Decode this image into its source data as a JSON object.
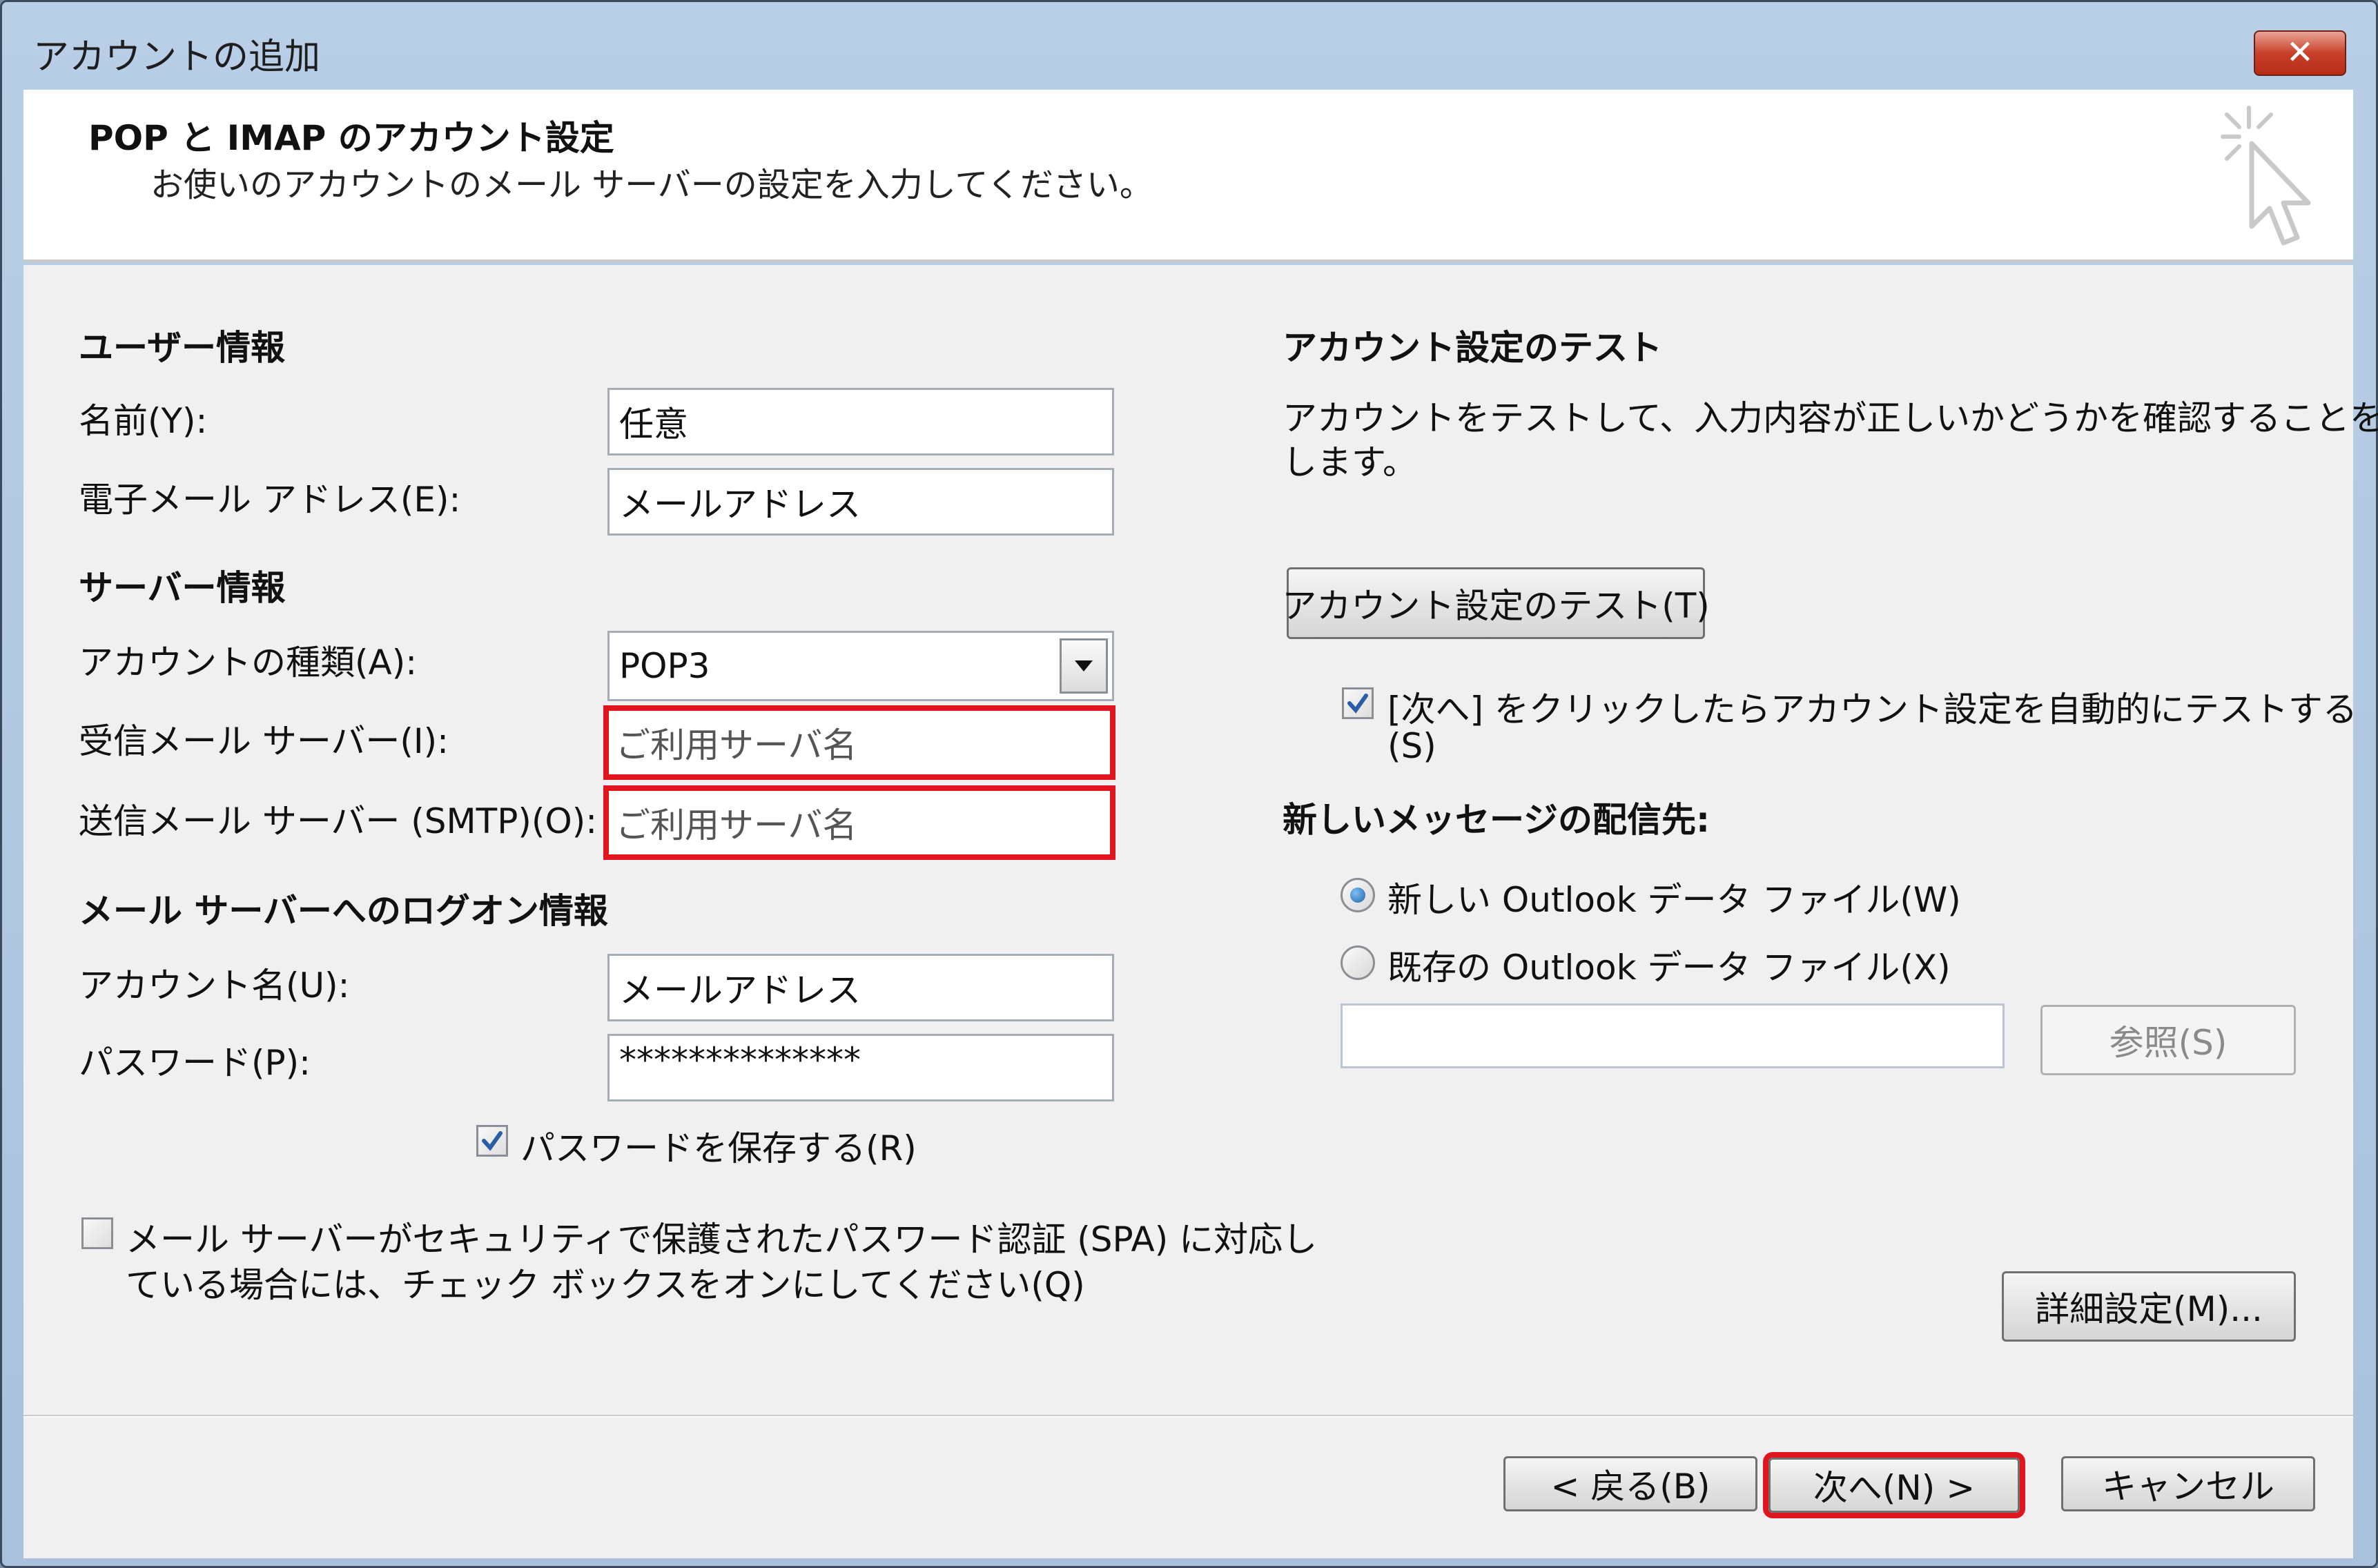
{
  "window": {
    "title": "アカウントの追加",
    "close_glyph": "✕"
  },
  "header": {
    "title": "POP と IMAP のアカウント設定",
    "subtitle": "お使いのアカウントのメール サーバーの設定を入力してください。"
  },
  "user_info": {
    "section_label": "ユーザー情報",
    "name_label": "名前(Y):",
    "name_value": "任意",
    "email_label": "電子メール アドレス(E):",
    "email_value": "メールアドレス"
  },
  "server_info": {
    "section_label": "サーバー情報",
    "account_type_label": "アカウントの種類(A):",
    "account_type_value": "POP3",
    "incoming_label": "受信メール サーバー(I):",
    "incoming_value": "ご利用サーバ名",
    "outgoing_label": "送信メール サーバー (SMTP)(O):",
    "outgoing_value": "ご利用サーバ名"
  },
  "logon_info": {
    "section_label": "メール サーバーへのログオン情報",
    "account_name_label": "アカウント名(U):",
    "account_name_value": "メールアドレス",
    "password_label": "パスワード(P):",
    "password_value": "**************",
    "save_password_label": "パスワードを保存する(R)",
    "save_password_checked": true,
    "spa_label_line1": "メール サーバーがセキュリティで保護されたパスワード認証 (SPA) に対応し",
    "spa_label_line2": "ている場合には、チェック ボックスをオンにしてください(Q)",
    "spa_checked": false
  },
  "test_settings": {
    "section_label": "アカウント設定のテスト",
    "description_line1": "アカウントをテストして、入力内容が正しいかどうかを確認することをお勧め",
    "description_line2": "します。",
    "test_button_label": "アカウント設定のテスト(T)",
    "auto_test_label_line1": "[次へ] をクリックしたらアカウント設定を自動的にテストする",
    "auto_test_label_line2": "(S)",
    "auto_test_checked": true
  },
  "delivery": {
    "section_label": "新しいメッセージの配信先:",
    "option_new_label": "新しい Outlook データ ファイル(W)",
    "option_existing_label": "既存の Outlook データ ファイル(X)",
    "selected": "new",
    "existing_file_value": "",
    "browse_label": "参照(S)"
  },
  "more_settings_label": "詳細設定(M)...",
  "footer": {
    "back_label": "< 戻る(B)",
    "next_label": "次へ(N) >",
    "cancel_label": "キャンセル"
  },
  "colors": {
    "highlight": "#e0161e",
    "radio_dot": "#1f5fa8",
    "close_button": "#c8402a"
  }
}
